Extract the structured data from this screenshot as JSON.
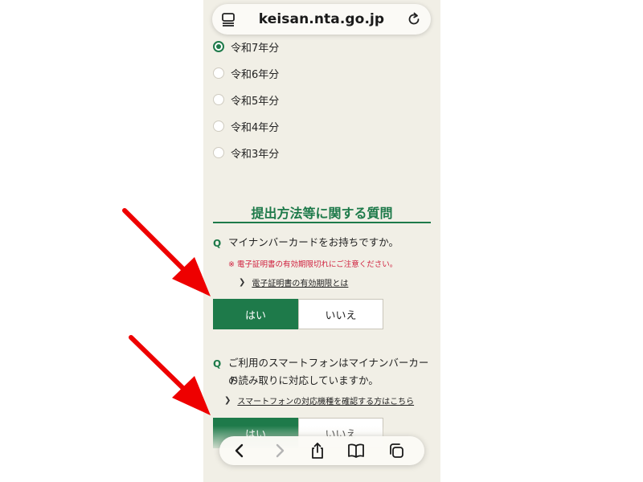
{
  "browser": {
    "url": "keisan.nta.go.jp",
    "icons": [
      "tab-overview-icon",
      "reload-icon",
      "back-icon",
      "forward-icon",
      "share-icon",
      "bookmarks-icon",
      "tabs-icon"
    ]
  },
  "year_options": [
    {
      "label": "令和7年分",
      "checked": true
    },
    {
      "label": "令和6年分",
      "checked": false
    },
    {
      "label": "令和5年分",
      "checked": false
    },
    {
      "label": "令和4年分",
      "checked": false
    },
    {
      "label": "令和3年分",
      "checked": false
    }
  ],
  "section": {
    "title": "提出方法等に関する質問"
  },
  "q1": {
    "mark": "Q",
    "text": "マイナンバーカードをお持ちですか。",
    "note": "※ 電子証明書の有効期限切れにご注意ください。",
    "link": "電子証明書の有効期限とは",
    "yes": "はい",
    "no": "いいえ"
  },
  "q2": {
    "mark": "Q",
    "line1": "ご利用のスマートフォンはマイナンバーカード",
    "line2": "の読み取りに対応していますか。",
    "link": "スマートフォンの対応機種を確認する方はこちら",
    "yes": "はい",
    "no": "いいえ"
  },
  "colors": {
    "accent": "#1e7a4a",
    "background": "#f1efe6",
    "note_red": "#d0203e",
    "arrow_red": "#ee0000"
  }
}
